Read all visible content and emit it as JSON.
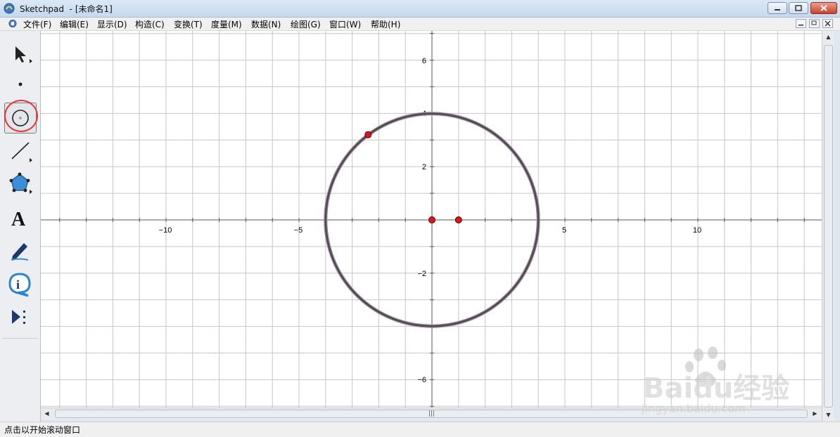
{
  "window": {
    "app_name": "Sketchpad",
    "doc_title": "- [未命名1]"
  },
  "menu": {
    "items": [
      "文件(F)",
      "编辑(E)",
      "显示(D)",
      "构造(C)",
      "变换(T)",
      "度量(M)",
      "数据(N)",
      "绘图(G)",
      "窗口(W)",
      "帮助(H)"
    ]
  },
  "toolbox": {
    "tools": [
      "selection-arrow-tool",
      "point-tool",
      "compass-tool",
      "straightedge-tool",
      "polygon-tool",
      "text-tool",
      "marker-tool",
      "information-tool",
      "custom-tools"
    ],
    "active_tool": "compass-tool",
    "highlight_color": "#e53636"
  },
  "graph": {
    "x_tick_labels": [
      "−10",
      "−5",
      "5",
      "10"
    ],
    "y_tick_labels": [
      "6",
      "2",
      "−2",
      "−6"
    ],
    "y_tick_label_4": "4",
    "x_range": [
      -14.7,
      14.7
    ],
    "y_range": [
      -7,
      7
    ],
    "grid": true,
    "circle": {
      "center": [
        0,
        0
      ],
      "radius": 4,
      "color": "#1b6e1b",
      "highlight_color": "#d45ad4"
    },
    "points": [
      {
        "name": "center",
        "x": 0,
        "y": 0,
        "color": "#e0141c"
      },
      {
        "name": "unit-point",
        "x": 1,
        "y": 0,
        "color": "#e0141c"
      },
      {
        "name": "on-circle",
        "x": -2.4,
        "y": 3.2,
        "color": "#e0141c"
      }
    ]
  },
  "status": {
    "text": "点击以开始滚动窗口"
  },
  "watermark": {
    "brand": "Baidu经验",
    "url": "jingyan.baidu.com"
  }
}
